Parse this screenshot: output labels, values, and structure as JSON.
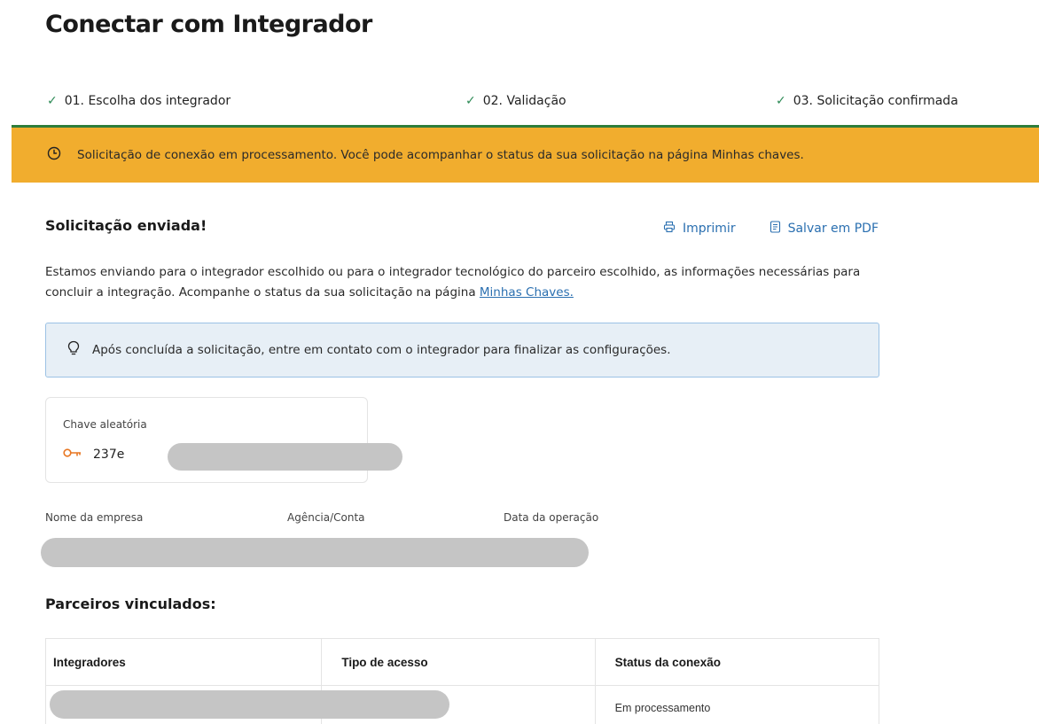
{
  "page": {
    "title": "Conectar com Integrador"
  },
  "steps": [
    {
      "label": "01. Escolha dos integrador",
      "status": "done"
    },
    {
      "label": "02. Validação",
      "status": "done"
    },
    {
      "label": "03. Solicitação confirmada",
      "status": "done"
    }
  ],
  "alert": {
    "icon": "clock-icon",
    "text": "Solicitação de conexão em processamento. Você pode acompanhar o status da sua solicitação na página Minhas chaves.",
    "color": "#f1ad2e"
  },
  "section": {
    "title": "Solicitação enviada!"
  },
  "actions": {
    "print_label": "Imprimir",
    "print_icon": "printer-icon",
    "pdf_label": "Salvar em PDF",
    "pdf_icon": "document-icon"
  },
  "description": {
    "text": "Estamos enviando para o integrador escolhido ou para o integrador tecnológico do parceiro escolhido, as informações necessárias para concluir a integração. Acompanhe o status da sua solicitação na página ",
    "link_label": "Minhas Chaves."
  },
  "tip": {
    "icon": "lightbulb-icon",
    "text": "Após concluída a solicitação, entre em contato com o integrador para finalizar as configurações."
  },
  "key_card": {
    "label": "Chave aleatória",
    "icon": "key-icon",
    "value_prefix": "237e"
  },
  "info": {
    "company_label": "Nome da empresa",
    "account_label": "Agência/Conta",
    "date_label": "Data da operação"
  },
  "partners": {
    "title": "Parceiros vinculados:",
    "columns": [
      "Integradores",
      "Tipo de acesso",
      "Status da conexão"
    ],
    "rows": [
      {
        "integrador": "",
        "tipo": "",
        "status": "Em processamento"
      }
    ]
  },
  "colors": {
    "accent_green": "#2f7d3b",
    "link_blue": "#2a6fb0",
    "tip_bg": "#e7eff6",
    "key_orange": "#e87722"
  }
}
